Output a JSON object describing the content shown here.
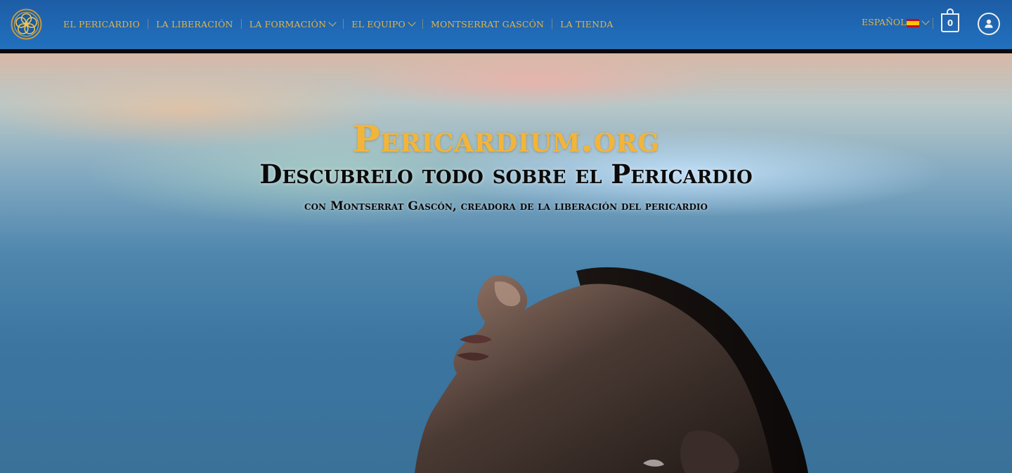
{
  "header": {
    "logo_icon": "golden-flower-mandala-icon",
    "nav": [
      {
        "label": "El Pericardio",
        "has_dropdown": false
      },
      {
        "label": "La Liberación",
        "has_dropdown": false
      },
      {
        "label": "La Formación",
        "has_dropdown": true
      },
      {
        "label": "El Equipo",
        "has_dropdown": true
      },
      {
        "label": "Montserrat Gascón",
        "has_dropdown": false
      },
      {
        "label": "La Tienda",
        "has_dropdown": false
      }
    ],
    "language": {
      "label": "Español",
      "flag": "spain-flag-icon"
    },
    "cart_count": "0",
    "account_icon": "user-icon"
  },
  "hero": {
    "site_title": "Pericardium.org",
    "headline": "Descubrelo todo sobre el Pericardio",
    "subline": "con Montserrat Gascón, creadora de la liberación del pericardio"
  },
  "colors": {
    "header_blue": "#1f67b4",
    "gold": "#e2b544",
    "title_gold": "#f2b53a",
    "dark_text": "#0b0b0b"
  }
}
